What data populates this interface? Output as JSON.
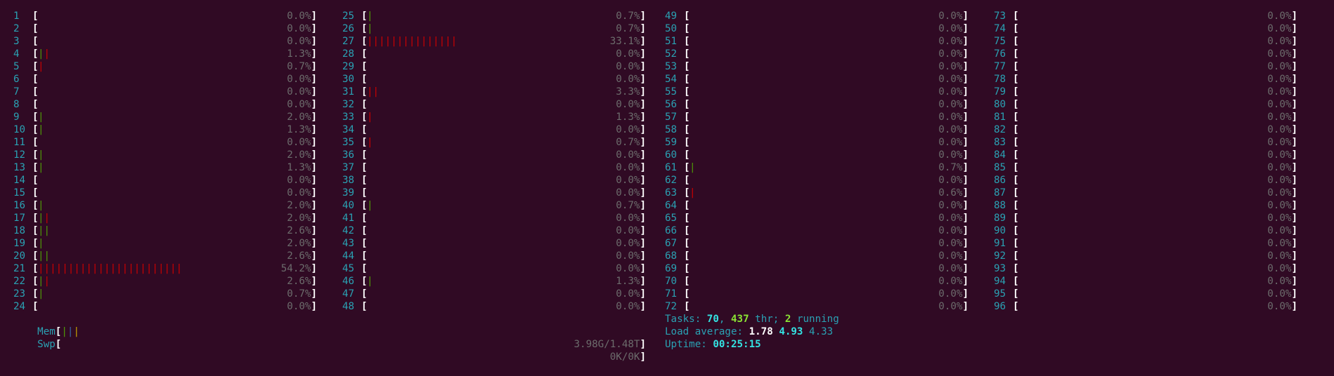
{
  "colors": {
    "background": "#300a24",
    "label": "#2aa1b3",
    "bar_low_priority": "#4e9a06",
    "bar_normal": "#cc0000",
    "bar_memory_buffers": "#c4a000",
    "percent_text": "#6c6c6c"
  },
  "cpus": [
    {
      "id": "1",
      "pct": "0.0%]",
      "bars": []
    },
    {
      "id": "2",
      "pct": "0.0%]",
      "bars": []
    },
    {
      "id": "3",
      "pct": "0.0%]",
      "bars": []
    },
    {
      "id": "4",
      "pct": "1.3%]",
      "bars": [
        "g",
        "r"
      ]
    },
    {
      "id": "5",
      "pct": "0.7%]",
      "bars": [
        "r"
      ]
    },
    {
      "id": "6",
      "pct": "0.0%]",
      "bars": []
    },
    {
      "id": "7",
      "pct": "0.0%]",
      "bars": []
    },
    {
      "id": "8",
      "pct": "0.0%]",
      "bars": []
    },
    {
      "id": "9",
      "pct": "2.0%]",
      "bars": [
        "g"
      ]
    },
    {
      "id": "10",
      "pct": "1.3%]",
      "bars": [
        "g"
      ]
    },
    {
      "id": "11",
      "pct": "0.0%]",
      "bars": []
    },
    {
      "id": "12",
      "pct": "2.0%]",
      "bars": [
        "g"
      ]
    },
    {
      "id": "13",
      "pct": "1.3%]",
      "bars": [
        "g"
      ]
    },
    {
      "id": "14",
      "pct": "0.0%]",
      "bars": []
    },
    {
      "id": "15",
      "pct": "0.0%]",
      "bars": []
    },
    {
      "id": "16",
      "pct": "2.0%]",
      "bars": [
        "g"
      ]
    },
    {
      "id": "17",
      "pct": "2.0%]",
      "bars": [
        "g",
        "r"
      ]
    },
    {
      "id": "18",
      "pct": "2.6%]",
      "bars": [
        "g",
        "g"
      ]
    },
    {
      "id": "19",
      "pct": "2.0%]",
      "bars": [
        "g"
      ]
    },
    {
      "id": "20",
      "pct": "2.6%]",
      "bars": [
        "g",
        "g"
      ]
    },
    {
      "id": "21",
      "pct": "54.2%]",
      "bars": [
        "r",
        "r",
        "r",
        "r",
        "r",
        "r",
        "r",
        "r",
        "r",
        "r",
        "r",
        "r",
        "r",
        "r",
        "r",
        "r",
        "r",
        "r",
        "r",
        "r",
        "r",
        "r",
        "r",
        "r"
      ]
    },
    {
      "id": "22",
      "pct": "2.6%]",
      "bars": [
        "g",
        "r"
      ]
    },
    {
      "id": "23",
      "pct": "0.7%]",
      "bars": [
        "g"
      ]
    },
    {
      "id": "24",
      "pct": "0.0%]",
      "bars": []
    },
    {
      "id": "25",
      "pct": "0.7%]",
      "bars": [
        "g"
      ]
    },
    {
      "id": "26",
      "pct": "0.7%]",
      "bars": [
        "g"
      ]
    },
    {
      "id": "27",
      "pct": "33.1%]",
      "bars": [
        "r",
        "r",
        "r",
        "r",
        "r",
        "r",
        "r",
        "r",
        "r",
        "r",
        "r",
        "r",
        "r",
        "r",
        "r"
      ]
    },
    {
      "id": "28",
      "pct": "0.0%]",
      "bars": []
    },
    {
      "id": "29",
      "pct": "0.0%]",
      "bars": []
    },
    {
      "id": "30",
      "pct": "0.0%]",
      "bars": []
    },
    {
      "id": "31",
      "pct": "3.3%]",
      "bars": [
        "r",
        "r"
      ]
    },
    {
      "id": "32",
      "pct": "0.0%]",
      "bars": []
    },
    {
      "id": "33",
      "pct": "1.3%]",
      "bars": [
        "r"
      ]
    },
    {
      "id": "34",
      "pct": "0.0%]",
      "bars": []
    },
    {
      "id": "35",
      "pct": "0.7%]",
      "bars": [
        "r"
      ]
    },
    {
      "id": "36",
      "pct": "0.0%]",
      "bars": []
    },
    {
      "id": "37",
      "pct": "0.0%]",
      "bars": []
    },
    {
      "id": "38",
      "pct": "0.0%]",
      "bars": []
    },
    {
      "id": "39",
      "pct": "0.0%]",
      "bars": []
    },
    {
      "id": "40",
      "pct": "0.7%]",
      "bars": [
        "g"
      ]
    },
    {
      "id": "41",
      "pct": "0.0%]",
      "bars": []
    },
    {
      "id": "42",
      "pct": "0.0%]",
      "bars": []
    },
    {
      "id": "43",
      "pct": "0.0%]",
      "bars": []
    },
    {
      "id": "44",
      "pct": "0.0%]",
      "bars": []
    },
    {
      "id": "45",
      "pct": "0.0%]",
      "bars": []
    },
    {
      "id": "46",
      "pct": "1.3%]",
      "bars": [
        "g"
      ]
    },
    {
      "id": "47",
      "pct": "0.0%]",
      "bars": []
    },
    {
      "id": "48",
      "pct": "0.0%]",
      "bars": []
    },
    {
      "id": "49",
      "pct": "0.0%]",
      "bars": []
    },
    {
      "id": "50",
      "pct": "0.0%]",
      "bars": []
    },
    {
      "id": "51",
      "pct": "0.0%]",
      "bars": []
    },
    {
      "id": "52",
      "pct": "0.0%]",
      "bars": []
    },
    {
      "id": "53",
      "pct": "0.0%]",
      "bars": []
    },
    {
      "id": "54",
      "pct": "0.0%]",
      "bars": []
    },
    {
      "id": "55",
      "pct": "0.0%]",
      "bars": []
    },
    {
      "id": "56",
      "pct": "0.0%]",
      "bars": []
    },
    {
      "id": "57",
      "pct": "0.0%]",
      "bars": []
    },
    {
      "id": "58",
      "pct": "0.0%]",
      "bars": []
    },
    {
      "id": "59",
      "pct": "0.0%]",
      "bars": []
    },
    {
      "id": "60",
      "pct": "0.0%]",
      "bars": []
    },
    {
      "id": "61",
      "pct": "0.7%]",
      "bars": [
        "g"
      ]
    },
    {
      "id": "62",
      "pct": "0.0%]",
      "bars": []
    },
    {
      "id": "63",
      "pct": "0.6%]",
      "bars": [
        "r"
      ]
    },
    {
      "id": "64",
      "pct": "0.0%]",
      "bars": []
    },
    {
      "id": "65",
      "pct": "0.0%]",
      "bars": []
    },
    {
      "id": "66",
      "pct": "0.0%]",
      "bars": []
    },
    {
      "id": "67",
      "pct": "0.0%]",
      "bars": []
    },
    {
      "id": "68",
      "pct": "0.0%]",
      "bars": []
    },
    {
      "id": "69",
      "pct": "0.0%]",
      "bars": []
    },
    {
      "id": "70",
      "pct": "0.0%]",
      "bars": []
    },
    {
      "id": "71",
      "pct": "0.0%]",
      "bars": []
    },
    {
      "id": "72",
      "pct": "0.0%]",
      "bars": []
    },
    {
      "id": "73",
      "pct": "0.0%]",
      "bars": []
    },
    {
      "id": "74",
      "pct": "0.0%]",
      "bars": []
    },
    {
      "id": "75",
      "pct": "0.0%]",
      "bars": []
    },
    {
      "id": "76",
      "pct": "0.0%]",
      "bars": []
    },
    {
      "id": "77",
      "pct": "0.0%]",
      "bars": []
    },
    {
      "id": "78",
      "pct": "0.0%]",
      "bars": []
    },
    {
      "id": "79",
      "pct": "0.0%]",
      "bars": []
    },
    {
      "id": "80",
      "pct": "0.0%]",
      "bars": []
    },
    {
      "id": "81",
      "pct": "0.0%]",
      "bars": []
    },
    {
      "id": "82",
      "pct": "0.0%]",
      "bars": []
    },
    {
      "id": "83",
      "pct": "0.0%]",
      "bars": []
    },
    {
      "id": "84",
      "pct": "0.0%]",
      "bars": []
    },
    {
      "id": "85",
      "pct": "0.0%]",
      "bars": []
    },
    {
      "id": "86",
      "pct": "0.0%]",
      "bars": []
    },
    {
      "id": "87",
      "pct": "0.0%]",
      "bars": []
    },
    {
      "id": "88",
      "pct": "0.0%]",
      "bars": []
    },
    {
      "id": "89",
      "pct": "0.0%]",
      "bars": []
    },
    {
      "id": "90",
      "pct": "0.0%]",
      "bars": []
    },
    {
      "id": "91",
      "pct": "0.0%]",
      "bars": []
    },
    {
      "id": "92",
      "pct": "0.0%]",
      "bars": []
    },
    {
      "id": "93",
      "pct": "0.0%]",
      "bars": []
    },
    {
      "id": "94",
      "pct": "0.0%]",
      "bars": []
    },
    {
      "id": "95",
      "pct": "0.0%]",
      "bars": []
    },
    {
      "id": "96",
      "pct": "0.0%]",
      "bars": []
    }
  ],
  "memory": {
    "mem_label": "Mem",
    "mem_bars": [
      "g",
      "b",
      "y"
    ],
    "mem_value": "3.98G/1.48T]",
    "swp_label": "Swp",
    "swp_value": "0K/0K]"
  },
  "tasks": {
    "label": "Tasks: ",
    "count": "70",
    "sep": ", ",
    "threads": "437",
    "thr_label": " thr; ",
    "running": "2",
    "running_label": " running"
  },
  "load": {
    "label": "Load average: ",
    "one": "1.78",
    "five": "4.93",
    "fifteen": "4.33"
  },
  "uptime": {
    "label": "Uptime: ",
    "value": "00:25:15"
  }
}
